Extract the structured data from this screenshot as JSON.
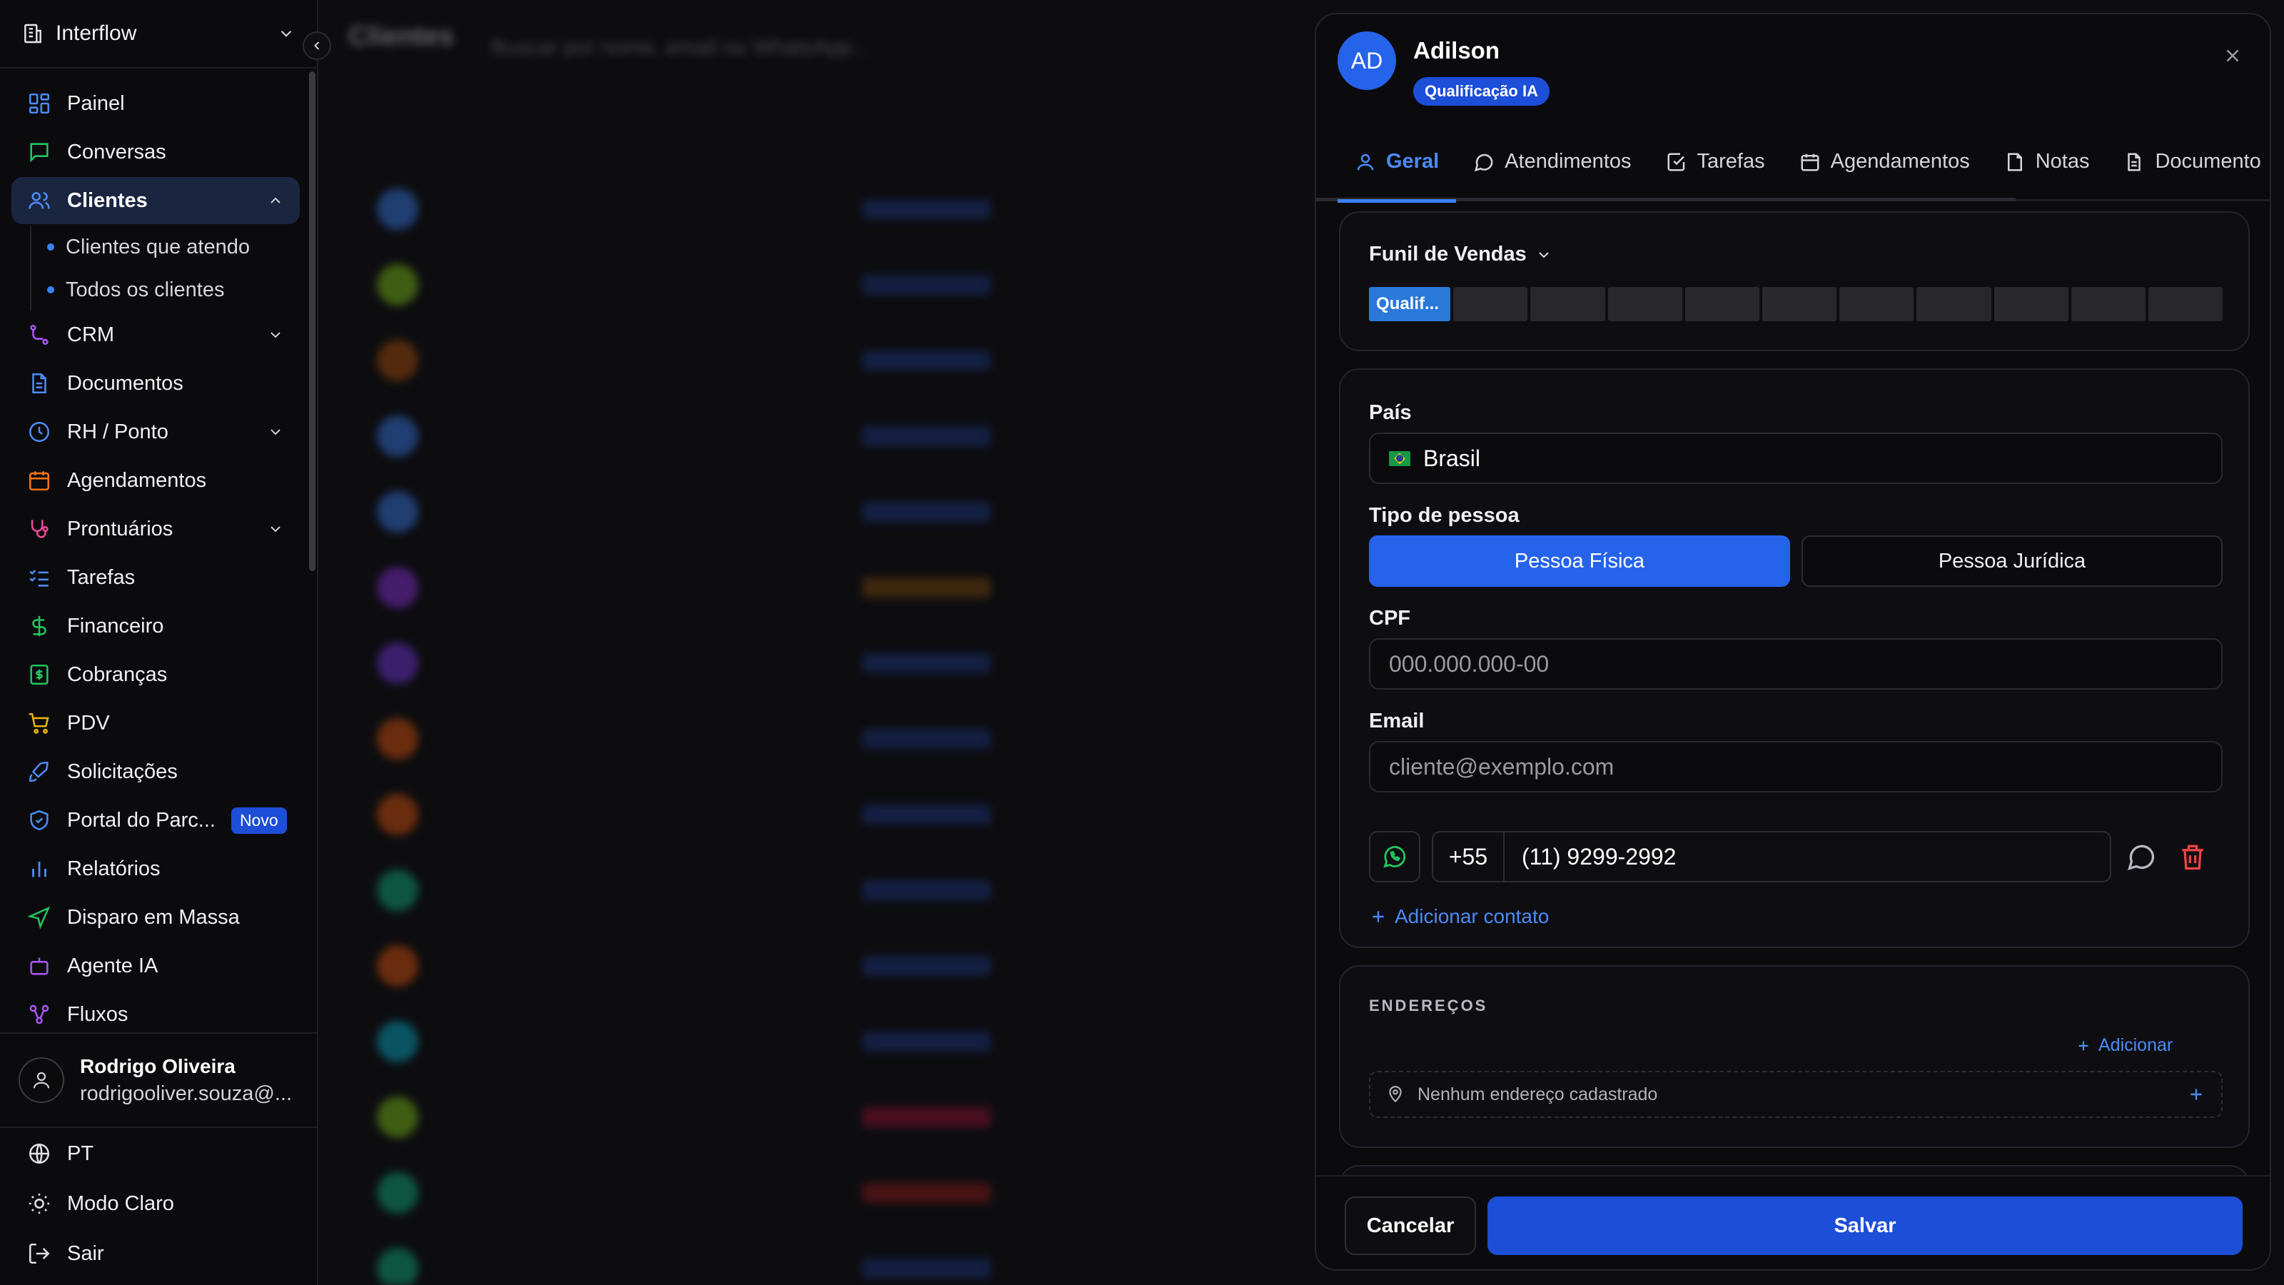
{
  "workspace": {
    "name": "Interflow"
  },
  "sidebar": {
    "items": [
      {
        "label": "Painel",
        "icon": "dashboard-icon"
      },
      {
        "label": "Conversas",
        "icon": "chat-icon"
      },
      {
        "label": "Clientes",
        "icon": "users-icon",
        "active": true
      },
      {
        "label": "CRM",
        "icon": "crm-icon"
      },
      {
        "label": "Documentos",
        "icon": "document-icon"
      },
      {
        "label": "RH / Ponto",
        "icon": "clock-icon"
      },
      {
        "label": "Agendamentos",
        "icon": "calendar-icon"
      },
      {
        "label": "Prontuários",
        "icon": "stethoscope-icon"
      },
      {
        "label": "Tarefas",
        "icon": "tasks-icon"
      },
      {
        "label": "Financeiro",
        "icon": "dollar-icon"
      },
      {
        "label": "Cobranças",
        "icon": "invoice-icon"
      },
      {
        "label": "PDV",
        "icon": "cart-icon"
      },
      {
        "label": "Solicitações",
        "icon": "rocket-icon"
      },
      {
        "label": "Portal do Parc...",
        "icon": "shield-icon",
        "badge": "Novo"
      },
      {
        "label": "Relatórios",
        "icon": "bar-chart-icon"
      },
      {
        "label": "Disparo em Massa",
        "icon": "send-icon"
      },
      {
        "label": "Agente IA",
        "icon": "bot-icon"
      },
      {
        "label": "Fluxos",
        "icon": "workflow-icon"
      }
    ],
    "clientes_sub": [
      "Clientes que atendo",
      "Todos os clientes"
    ],
    "user": {
      "name": "Rodrigo Oliveira",
      "email": "rodrigooliver.souza@..."
    },
    "bottom": [
      {
        "label": "PT",
        "icon": "globe-icon"
      },
      {
        "label": "Modo Claro",
        "icon": "sun-icon"
      },
      {
        "label": "Sair",
        "icon": "logout-icon"
      }
    ]
  },
  "background": {
    "title": "Clientes",
    "search_placeholder": "Buscar por nome, email ou WhatsApp..."
  },
  "drawer": {
    "initials": "AD",
    "name": "Adilson",
    "stage_badge": "Qualificação IA",
    "tabs": [
      "Geral",
      "Atendimentos",
      "Tarefas",
      "Agendamentos",
      "Notas",
      "Documento"
    ],
    "funnel": {
      "title": "Funil de Vendas",
      "current_stage": "Qualif...",
      "stage_count": 11,
      "active_index": 0
    },
    "pais_label": "País",
    "pais_value": "Brasil",
    "tipo_label": "Tipo de pessoa",
    "tipo_fisica": "Pessoa Física",
    "tipo_juridica": "Pessoa Jurídica",
    "cpf_label": "CPF",
    "cpf_placeholder": "000.000.000-00",
    "email_label": "Email",
    "email_placeholder": "cliente@exemplo.com",
    "phone_country_code": "+55",
    "phone_number": "(11) 9299-2992",
    "add_contact": "Adicionar contato",
    "enderecos_title": "ENDEREÇOS",
    "add_address": "Adicionar",
    "no_address": "Nenhum endereço cadastrado",
    "cancel": "Cancelar",
    "save": "Salvar"
  },
  "colors": {
    "accent": "#2563eb",
    "link": "#4b8bf5",
    "delete": "#ef4444",
    "whatsapp": "#22c55e"
  }
}
